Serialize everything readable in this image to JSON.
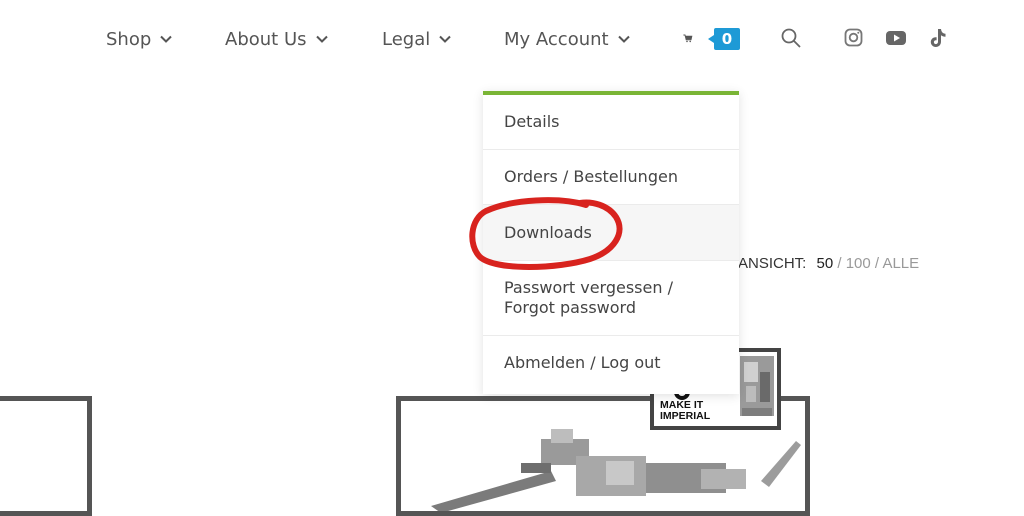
{
  "nav": {
    "items": [
      {
        "label": "Shop"
      },
      {
        "label": "About Us"
      },
      {
        "label": "Legal"
      },
      {
        "label": "My Account"
      }
    ],
    "cart_count": "0"
  },
  "dropdown": {
    "accent_color": "#7ab536",
    "items": [
      {
        "label": "Details"
      },
      {
        "label": "Orders / Bestellungen"
      },
      {
        "label": "Downloads"
      },
      {
        "label": "Passwort vergessen / Forgot password"
      },
      {
        "label": "Abmelden / Log out"
      }
    ]
  },
  "view": {
    "label": "ANSICHT:",
    "selected": "50",
    "options": [
      "100",
      "ALLE"
    ],
    "separator": "/"
  },
  "product_badge": {
    "text_line1": "MAKE IT",
    "text_line2": "IMPERIAL"
  },
  "colors": {
    "badge": "#1e9ad6",
    "annotation": "#d8231e"
  }
}
